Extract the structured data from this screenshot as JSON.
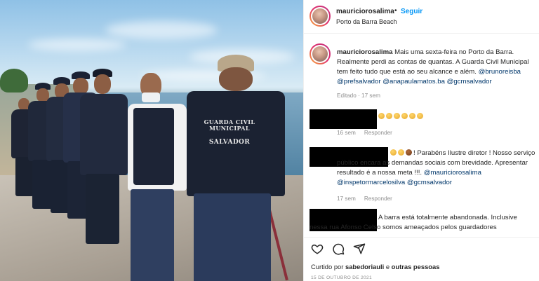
{
  "post": {
    "username": "mauriciorosalima",
    "separator": "•",
    "follow_label": "Seguir",
    "location": "Porto da Barra Beach",
    "photo": {
      "shirt_text_line1": "GUARDA CIVIL MUNICIPAL",
      "shirt_text_line2": "SALVADOR"
    }
  },
  "caption": {
    "username": "mauriciorosalima",
    "text_part1": "Mais uma sexta-feira no Porto da Barra. Realmente perdi as contas de quantas. A Guarda Civil Municipal tem feito tudo que está ao seu alcance e além. ",
    "mention1": "@brunoreisba",
    "mention2": "@prefsalvador",
    "mention3": "@anapaulamatos.ba",
    "mention4": "@gcmsalvador",
    "meta": "Editado · 17 sem"
  },
  "comments": [
    {
      "meta_time": "16 sem",
      "reply_label": "Responder",
      "emoji_count": 6
    },
    {
      "text": "! Parabéns Ilustre diretor ! Nosso serviço público encara as demandas sociais com brevidade. Apresentar resultado é a nossa meta !!!. ",
      "mention1": "@mauriciorosalima",
      "mention2": "@inspetormarcelosilva",
      "mention3": "@gcmsalvador",
      "meta_time": "17 sem",
      "reply_label": "Responder"
    },
    {
      "text_line1": "A barra está totalmente abandonada. Inclusive",
      "text_line2": "nessa rua Afonso Celso somos ameaçados pelos guardadores"
    }
  ],
  "actions": {
    "like_icon": "heart-icon",
    "comment_icon": "comment-icon",
    "share_icon": "share-icon"
  },
  "likes": {
    "prefix": "Curtido por ",
    "user": "sabedoriauli",
    "suffix": " e ",
    "others": "outras pessoas"
  },
  "date": "15 DE OUTUBRO DE 2021",
  "colors": {
    "accent": "#0095f6",
    "link": "#00376b",
    "muted": "#8e8e8e"
  }
}
